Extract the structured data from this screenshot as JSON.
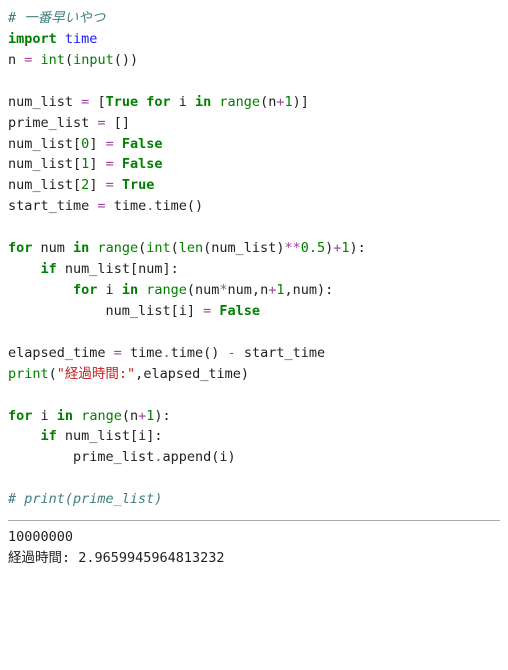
{
  "code": {
    "l1": {
      "comment": "# 一番早いやつ"
    },
    "l2": {
      "kw1": "import",
      "sp": " ",
      "mod": "time"
    },
    "l3": {
      "v": "n ",
      "op1": "=",
      "sp1": " ",
      "fn": "int",
      "lp": "(",
      "fn2": "input",
      "lp2": "(",
      "rp2": ")",
      "rp": ")"
    },
    "l5": {
      "v": "num_list ",
      "op1": "=",
      "sp": " ",
      "lb": "[",
      "val": "True",
      "sp2": " ",
      "kw1": "for",
      "sp3": " i ",
      "kw2": "in",
      "sp4": " ",
      "fn": "range",
      "lp": "(",
      "arg": "n",
      "op2": "+",
      "num": "1",
      "rp": ")",
      "rb": "]"
    },
    "l6": {
      "v": "prime_list ",
      "op1": "=",
      "sp": " ",
      "lb": "[",
      "rb": "]"
    },
    "l7": {
      "v": "num_list",
      "lb": "[",
      "num": "0",
      "rb": "]",
      "sp": " ",
      "op1": "=",
      "sp2": " ",
      "val": "False"
    },
    "l8": {
      "v": "num_list",
      "lb": "[",
      "num": "1",
      "rb": "]",
      "sp": " ",
      "op1": "=",
      "sp2": " ",
      "val": "False"
    },
    "l9": {
      "v": "num_list",
      "lb": "[",
      "num": "2",
      "rb": "]",
      "sp": " ",
      "op1": "=",
      "sp2": " ",
      "val": "True"
    },
    "l10": {
      "v": "start_time ",
      "op1": "=",
      "sp": " ",
      "mod": "time",
      "dot": ".",
      "fn": "time",
      "lp": "(",
      "rp": ")"
    },
    "l12": {
      "kw1": "for",
      "sp1": " num ",
      "kw2": "in",
      "sp2": " ",
      "fn": "range",
      "lp": "(",
      "fn2": "int",
      "lp2": "(",
      "fn3": "len",
      "lp3": "(",
      "arg": "num_list",
      "rp3": ")",
      "op1": "**",
      "num1": "0.5",
      "rp2": ")",
      "op2": "+",
      "num2": "1",
      "rp": ")",
      "colon": ":"
    },
    "l13": {
      "indent": "    ",
      "kw1": "if",
      "sp": " ",
      "arg": "num_list",
      "lb": "[",
      "idx": "num",
      "rb": "]",
      "colon": ":"
    },
    "l14": {
      "indent": "        ",
      "kw1": "for",
      "sp1": " i ",
      "kw2": "in",
      "sp2": " ",
      "fn": "range",
      "lp": "(",
      "a1": "num",
      "op1": "*",
      "a2": "num",
      "c1": ",",
      "a3": "n",
      "op2": "+",
      "num": "1",
      "c2": ",",
      "a4": "num",
      "rp": ")",
      "colon": ":"
    },
    "l15": {
      "indent": "            ",
      "arg": "num_list",
      "lb": "[",
      "idx": "i",
      "rb": "]",
      "sp": " ",
      "op1": "=",
      "sp2": " ",
      "val": "False"
    },
    "l17": {
      "v": "elapsed_time ",
      "op1": "=",
      "sp": " ",
      "mod": "time",
      "dot": ".",
      "fn": "time",
      "lp": "(",
      "rp": ")",
      "sp2": " ",
      "op2": "-",
      "sp3": " ",
      "v2": "start_time"
    },
    "l18": {
      "fn": "print",
      "lp": "(",
      "str": "\"経過時間:\"",
      "c": ",",
      "arg": "elapsed_time",
      "rp": ")"
    },
    "l20": {
      "kw1": "for",
      "sp1": " i ",
      "kw2": "in",
      "sp2": " ",
      "fn": "range",
      "lp": "(",
      "arg": "n",
      "op1": "+",
      "num": "1",
      "rp": ")",
      "colon": ":"
    },
    "l21": {
      "indent": "    ",
      "kw1": "if",
      "sp": " ",
      "arg": "num_list",
      "lb": "[",
      "idx": "i",
      "rb": "]",
      "colon": ":"
    },
    "l22": {
      "indent": "        ",
      "obj": "prime_list",
      "dot": ".",
      "fn": "append",
      "lp": "(",
      "arg": "i",
      "rp": ")"
    },
    "l24": {
      "comment": "# print(prime_list)"
    }
  },
  "output": {
    "line1": "10000000",
    "line2": "経過時間: 2.9659945964813232"
  }
}
